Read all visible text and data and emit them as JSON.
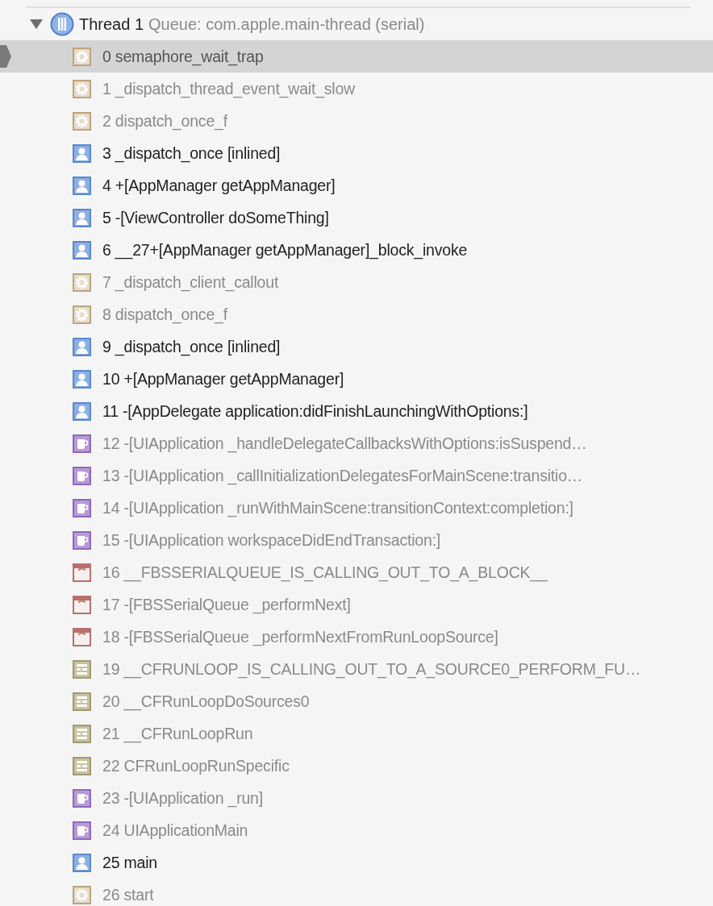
{
  "thread": {
    "name": "Thread 1",
    "queue": "Queue: com.apple.main-thread (serial)",
    "expanded": true
  },
  "frames": [
    {
      "label": "0 semaphore_wait_trap",
      "kind": "system",
      "selected": true
    },
    {
      "label": "1 _dispatch_thread_event_wait_slow",
      "kind": "system",
      "selected": false
    },
    {
      "label": "2 dispatch_once_f",
      "kind": "system",
      "selected": false
    },
    {
      "label": "3 _dispatch_once [inlined]",
      "kind": "user",
      "selected": false
    },
    {
      "label": "4 +[AppManager getAppManager]",
      "kind": "user",
      "selected": false
    },
    {
      "label": "5 -[ViewController doSomeThing]",
      "kind": "user",
      "selected": false
    },
    {
      "label": "6 __27+[AppManager getAppManager]_block_invoke",
      "kind": "user",
      "selected": false
    },
    {
      "label": "7 _dispatch_client_callout",
      "kind": "system",
      "selected": false
    },
    {
      "label": "8 dispatch_once_f",
      "kind": "system",
      "selected": false
    },
    {
      "label": "9 _dispatch_once [inlined]",
      "kind": "user",
      "selected": false
    },
    {
      "label": "10 +[AppManager getAppManager]",
      "kind": "user",
      "selected": false
    },
    {
      "label": "11 -[AppDelegate application:didFinishLaunchingWithOptions:]",
      "kind": "user",
      "selected": false
    },
    {
      "label": "12 -[UIApplication _handleDelegateCallbacksWithOptions:isSuspend…",
      "kind": "uikit",
      "selected": false
    },
    {
      "label": "13 -[UIApplication _callInitializationDelegatesForMainScene:transitio…",
      "kind": "uikit",
      "selected": false
    },
    {
      "label": "14 -[UIApplication _runWithMainScene:transitionContext:completion:]",
      "kind": "uikit",
      "selected": false
    },
    {
      "label": "15 -[UIApplication workspaceDidEndTransaction:]",
      "kind": "uikit",
      "selected": false
    },
    {
      "label": "16 __FBSSERIALQUEUE_IS_CALLING_OUT_TO_A_BLOCK__",
      "kind": "frontboard",
      "selected": false
    },
    {
      "label": "17 -[FBSSerialQueue _performNext]",
      "kind": "frontboard",
      "selected": false
    },
    {
      "label": "18 -[FBSSerialQueue _performNextFromRunLoopSource]",
      "kind": "frontboard",
      "selected": false
    },
    {
      "label": "19 __CFRUNLOOP_IS_CALLING_OUT_TO_A_SOURCE0_PERFORM_FU…",
      "kind": "corefoundation",
      "selected": false
    },
    {
      "label": "20 __CFRunLoopDoSources0",
      "kind": "corefoundation",
      "selected": false
    },
    {
      "label": "21 __CFRunLoopRun",
      "kind": "corefoundation",
      "selected": false
    },
    {
      "label": "22 CFRunLoopRunSpecific",
      "kind": "corefoundation",
      "selected": false
    },
    {
      "label": "23 -[UIApplication _run]",
      "kind": "uikit",
      "selected": false
    },
    {
      "label": "24 UIApplicationMain",
      "kind": "uikit",
      "selected": false
    },
    {
      "label": "25 main",
      "kind": "user",
      "selected": false
    },
    {
      "label": "26 start",
      "kind": "system",
      "selected": false
    }
  ]
}
